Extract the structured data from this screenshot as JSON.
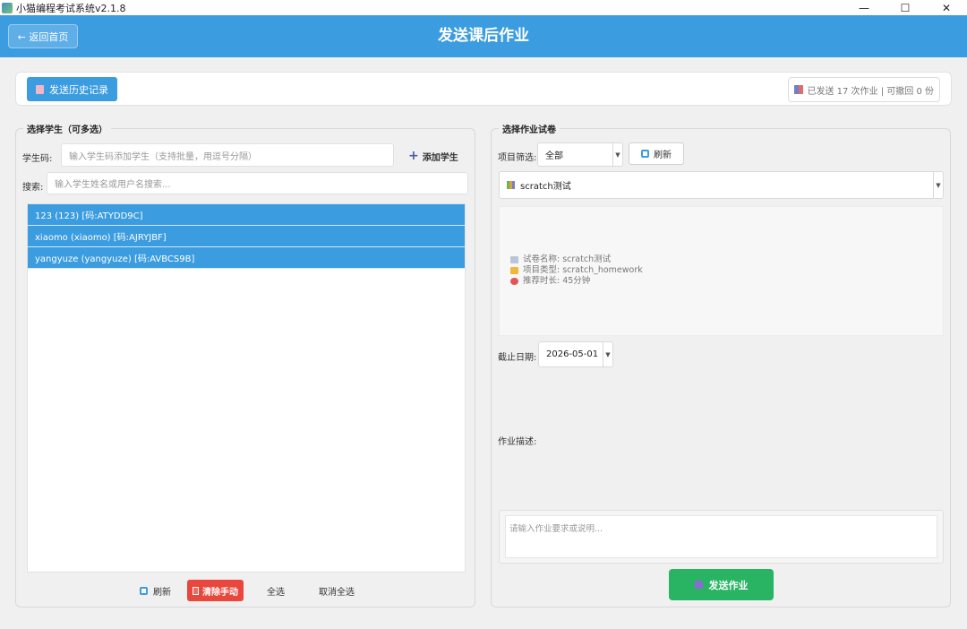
{
  "window": {
    "title": "小猫编程考试系统v2.1.8",
    "minimize": "—",
    "maximize": "☐",
    "close": "✕"
  },
  "header": {
    "back_label": "← 返回首页",
    "title": "发送课后作业"
  },
  "toolbar": {
    "history_label": "发送历史记录",
    "stats_text": "已发送 17 次作业 | 可撤回 0 份"
  },
  "left_panel": {
    "group_title": "选择学生（可多选）",
    "code_label": "学生码:",
    "code_placeholder": "输入学生码添加学生（支持批量，用逗号分隔）",
    "add_label": "添加学生",
    "search_label": "搜索:",
    "search_placeholder": "输入学生姓名或用户名搜索...",
    "students": [
      "123 (123) [码:ATYDD9C]",
      "xiaomo (xiaomo) [码:AJRYJBF]",
      "yangyuze (yangyuze) [码:AVBCS9B]"
    ],
    "refresh_label": "刷新",
    "clear_label": "清除手动",
    "select_all_label": "全选",
    "deselect_all_label": "取消全选"
  },
  "right_panel": {
    "group_title": "选择作业试卷",
    "filter_label": "项目筛选:",
    "filter_value": "全部",
    "refresh_label": "刷新",
    "paper_value": "scratch测试",
    "info": {
      "name": "试卷名称: scratch测试",
      "type": "项目类型: scratch_homework",
      "duration": "推荐时长: 45分钟"
    },
    "deadline_label": "截止日期:",
    "deadline_value": "2026-05-01",
    "desc_label": "作业描述:",
    "desc_placeholder": "请输入作业要求或说明...",
    "send_label": "发送作业"
  },
  "colors": {
    "primary": "#3b9ce0",
    "danger": "#e8473d",
    "success": "#28b463"
  }
}
